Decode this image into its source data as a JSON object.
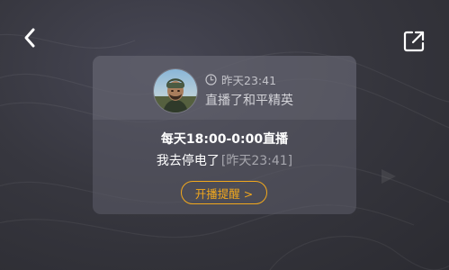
{
  "nav": {
    "back_icon": "chevron-left-icon",
    "share_icon": "share-external-icon"
  },
  "card": {
    "avatar_icon": "user-avatar",
    "last_live_time": "昨天23:41",
    "status": "直播了和平精英",
    "schedule": "每天18:00-0:00直播",
    "message": "我去停电了",
    "message_time": "[昨天23:41]",
    "remind_button": "开播提醒 >"
  },
  "colors": {
    "background": "#37373f",
    "card": "#5c5c68",
    "accent": "#f2a81d",
    "text_primary": "#ffffff",
    "text_secondary": "#a6a6ad"
  }
}
